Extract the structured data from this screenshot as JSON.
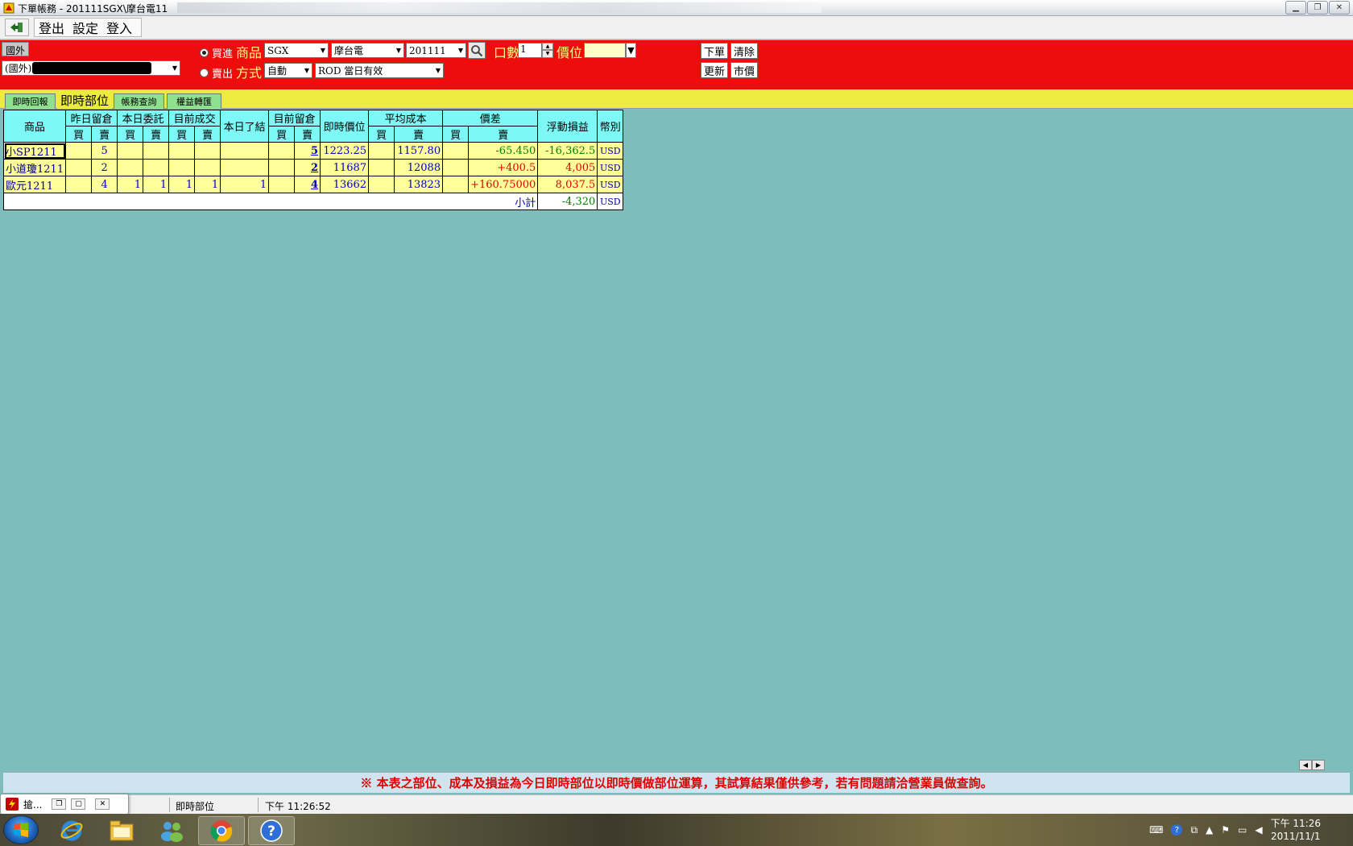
{
  "window": {
    "title": "下單帳務 - 201111SGX\\摩台電11"
  },
  "menu": {
    "items": [
      "登出",
      "設定",
      "登入"
    ]
  },
  "order": {
    "market_badge": "國外",
    "account_value": "(國外)",
    "buy_label": "買進",
    "sell_label": "賣出",
    "side_selected": "買進",
    "product_label": "商品",
    "exchange_value": "SGX",
    "commodity_value": "摩台電",
    "month_value": "201111",
    "qty_label": "口數",
    "qty_value": "1",
    "price_label": "價位",
    "price_value": "",
    "method_label": "方式",
    "method_value": "自動",
    "tif_value": "ROD 當日有效",
    "btn_order": "下單",
    "btn_clear": "清除",
    "btn_update": "更新",
    "btn_market": "市價"
  },
  "tabs": [
    {
      "label": "即時回報",
      "active": false
    },
    {
      "label": "即時部位",
      "active": true
    },
    {
      "label": "帳務查詢",
      "active": false
    },
    {
      "label": "權益轉匯",
      "active": false
    }
  ],
  "grid": {
    "headers": {
      "product": "商品",
      "prev_position": "昨日留倉",
      "today_orders": "本日委託",
      "current_fills": "目前成交",
      "today_closed": "本日了結",
      "current_position": "目前留倉",
      "live_price": "即時價位",
      "avg_cost": "平均成本",
      "price_diff": "價差",
      "floating_pnl": "浮動損益",
      "currency": "幣別",
      "buy": "買",
      "sell": "賣"
    },
    "rows": [
      {
        "product": "小SP1211",
        "prev_buy": "",
        "prev_sell": "5",
        "ord_buy": "",
        "ord_sell": "",
        "fill_buy": "",
        "fill_sell": "",
        "closed": "",
        "pos_buy": "",
        "pos_sell": "5",
        "price": "1223.25",
        "cost_buy": "",
        "cost_sell": "1157.80",
        "diff_buy": "",
        "diff_sell": "-65.450",
        "pnl": "-16,362.5",
        "currency": "USD",
        "diff_color": "green",
        "pnl_color": "green"
      },
      {
        "product": "小道瓊1211",
        "prev_buy": "",
        "prev_sell": "2",
        "ord_buy": "",
        "ord_sell": "",
        "fill_buy": "",
        "fill_sell": "",
        "closed": "",
        "pos_buy": "",
        "pos_sell": "2",
        "price": "11687",
        "cost_buy": "",
        "cost_sell": "12088",
        "diff_buy": "",
        "diff_sell": "+400.5",
        "pnl": "4,005",
        "currency": "USD",
        "diff_color": "red",
        "pnl_color": "red"
      },
      {
        "product": "歐元1211",
        "prev_buy": "",
        "prev_sell": "4",
        "ord_buy": "1",
        "ord_sell": "1",
        "fill_buy": "1",
        "fill_sell": "1",
        "closed": "1",
        "pos_buy": "",
        "pos_sell": "4",
        "price": "13662",
        "cost_buy": "",
        "cost_sell": "13823",
        "diff_buy": "",
        "diff_sell": "+160.75000",
        "pnl": "8,037.5",
        "currency": "USD",
        "diff_color": "red",
        "pnl_color": "red"
      }
    ],
    "subtotal": {
      "label": "小計",
      "pnl": "-4,320",
      "currency": "USD"
    }
  },
  "notice": "※  本表之部位、成本及損益為今日即時部位以即時價做部位運算，其試算結果僅供參考，若有問題請洽營業員做查詢。",
  "status": {
    "minimized_title": "搶...",
    "tab_name": "即時部位",
    "time": "下午 11:26:52"
  },
  "taskbar": {
    "clock_time": "下午 11:26",
    "clock_date": "2011/11/1"
  },
  "colors": {
    "panel_red": "#ee0d0d",
    "tab_yellow": "#ecec40",
    "header_cyan": "#7ef7f7",
    "cell_yellow": "#ffff9a",
    "background_teal": "#7dbdbb"
  }
}
